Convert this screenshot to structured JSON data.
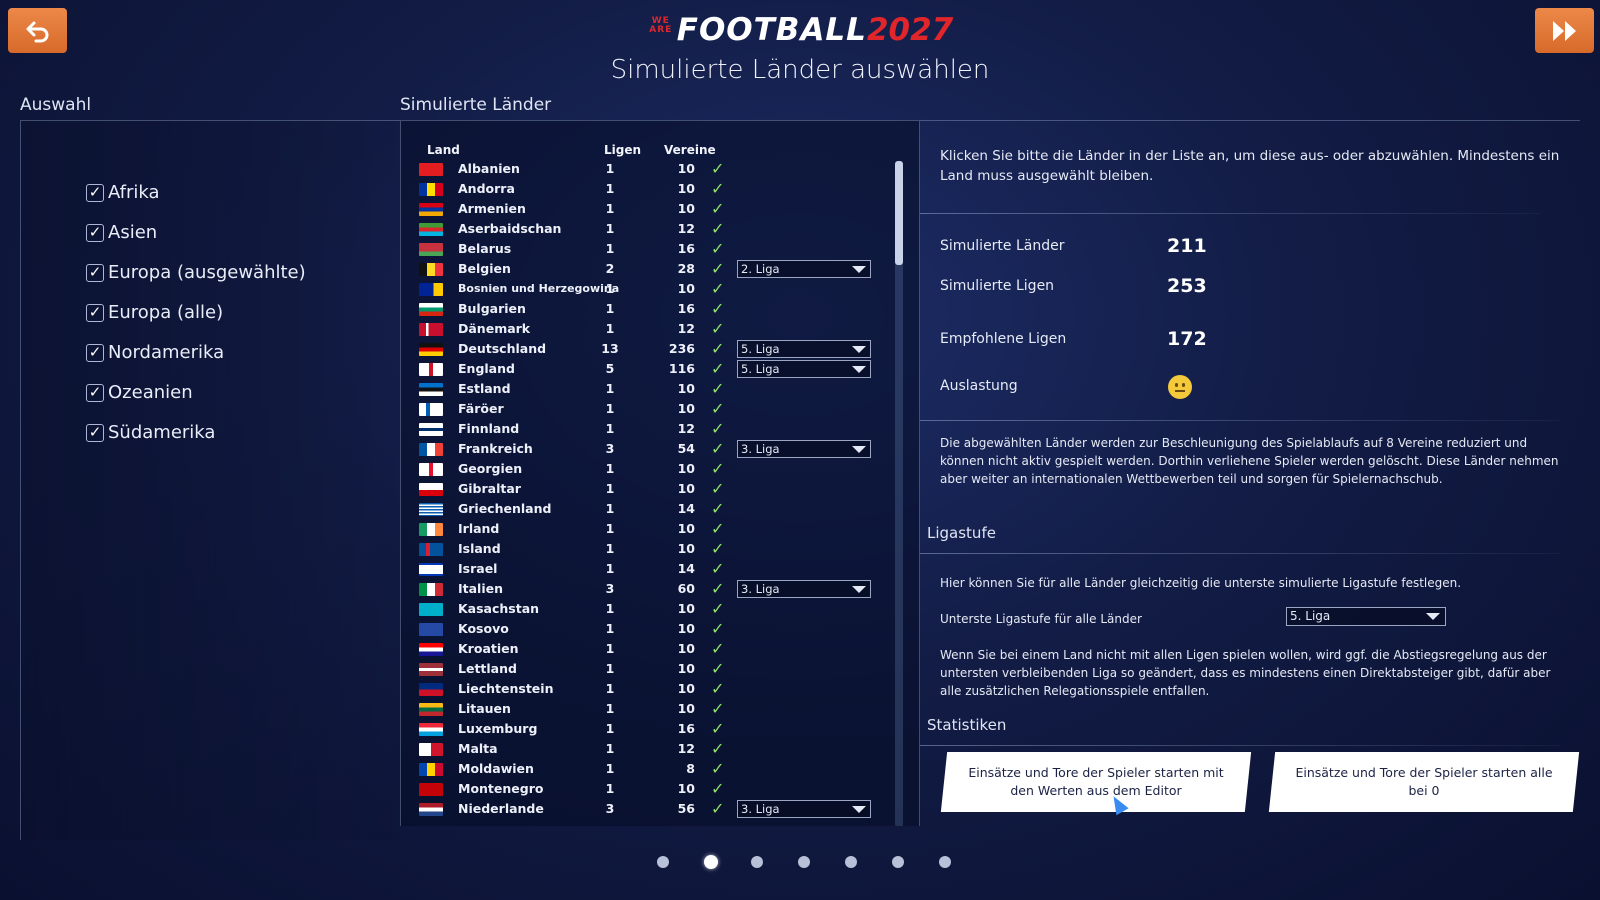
{
  "header": {
    "logo_we": "WE ARE",
    "logo_main": "FOOTBALL",
    "logo_year": "2027",
    "title": "Simulierte Länder auswählen"
  },
  "colors": {
    "accent_orange": "#e47b3a",
    "logo_red": "#e0262b",
    "check_green": "#8fe06a"
  },
  "icons": {
    "back": "undo-arrow-icon",
    "forward": "fast-forward-icon",
    "auslastung": "neutral-face-emoji"
  },
  "selection": {
    "label": "Auswahl",
    "regions": [
      {
        "label": "Afrika",
        "checked": true
      },
      {
        "label": "Asien",
        "checked": true
      },
      {
        "label": "Europa (ausgewählte)",
        "checked": true
      },
      {
        "label": "Europa (alle)",
        "checked": true
      },
      {
        "label": "Nordamerika",
        "checked": true
      },
      {
        "label": "Ozeanien",
        "checked": true
      },
      {
        "label": "Südamerika",
        "checked": true
      }
    ]
  },
  "countries": {
    "label": "Simulierte Länder",
    "headers": {
      "land": "Land",
      "ligen": "Ligen",
      "vereine": "Vereine"
    },
    "rows": [
      {
        "name": "Albanien",
        "leagues": "1",
        "clubs": "10",
        "level": ""
      },
      {
        "name": "Andorra",
        "leagues": "1",
        "clubs": "10",
        "level": ""
      },
      {
        "name": "Armenien",
        "leagues": "1",
        "clubs": "10",
        "level": ""
      },
      {
        "name": "Aserbaidschan",
        "leagues": "1",
        "clubs": "12",
        "level": ""
      },
      {
        "name": "Belarus",
        "leagues": "1",
        "clubs": "16",
        "level": ""
      },
      {
        "name": "Belgien",
        "leagues": "2",
        "clubs": "28",
        "level": "2. Liga"
      },
      {
        "name": "Bosnien und Herzegowina",
        "leagues": "1",
        "clubs": "10",
        "level": ""
      },
      {
        "name": "Bulgarien",
        "leagues": "1",
        "clubs": "16",
        "level": ""
      },
      {
        "name": "Dänemark",
        "leagues": "1",
        "clubs": "12",
        "level": ""
      },
      {
        "name": "Deutschland",
        "leagues": "13",
        "clubs": "236",
        "level": "5. Liga"
      },
      {
        "name": "England",
        "leagues": "5",
        "clubs": "116",
        "level": "5. Liga"
      },
      {
        "name": "Estland",
        "leagues": "1",
        "clubs": "10",
        "level": ""
      },
      {
        "name": "Färöer",
        "leagues": "1",
        "clubs": "10",
        "level": ""
      },
      {
        "name": "Finnland",
        "leagues": "1",
        "clubs": "12",
        "level": ""
      },
      {
        "name": "Frankreich",
        "leagues": "3",
        "clubs": "54",
        "level": "3. Liga"
      },
      {
        "name": "Georgien",
        "leagues": "1",
        "clubs": "10",
        "level": ""
      },
      {
        "name": "Gibraltar",
        "leagues": "1",
        "clubs": "10",
        "level": ""
      },
      {
        "name": "Griechenland",
        "leagues": "1",
        "clubs": "14",
        "level": ""
      },
      {
        "name": "Irland",
        "leagues": "1",
        "clubs": "10",
        "level": ""
      },
      {
        "name": "Island",
        "leagues": "1",
        "clubs": "10",
        "level": ""
      },
      {
        "name": "Israel",
        "leagues": "1",
        "clubs": "14",
        "level": ""
      },
      {
        "name": "Italien",
        "leagues": "3",
        "clubs": "60",
        "level": "3. Liga"
      },
      {
        "name": "Kasachstan",
        "leagues": "1",
        "clubs": "10",
        "level": ""
      },
      {
        "name": "Kosovo",
        "leagues": "1",
        "clubs": "10",
        "level": ""
      },
      {
        "name": "Kroatien",
        "leagues": "1",
        "clubs": "10",
        "level": ""
      },
      {
        "name": "Lettland",
        "leagues": "1",
        "clubs": "10",
        "level": ""
      },
      {
        "name": "Liechtenstein",
        "leagues": "1",
        "clubs": "10",
        "level": ""
      },
      {
        "name": "Litauen",
        "leagues": "1",
        "clubs": "10",
        "level": ""
      },
      {
        "name": "Luxemburg",
        "leagues": "1",
        "clubs": "16",
        "level": ""
      },
      {
        "name": "Malta",
        "leagues": "1",
        "clubs": "12",
        "level": ""
      },
      {
        "name": "Moldawien",
        "leagues": "1",
        "clubs": "8",
        "level": ""
      },
      {
        "name": "Montenegro",
        "leagues": "1",
        "clubs": "10",
        "level": ""
      },
      {
        "name": "Niederlande",
        "leagues": "3",
        "clubs": "56",
        "level": "3. Liga"
      }
    ]
  },
  "info": {
    "intro": "Klicken Sie bitte die Länder in der Liste an, um diese aus- oder abzuwählen. Mindestens ein Land muss ausgewählt bleiben.",
    "stats": {
      "simulated_countries_label": "Simulierte Länder",
      "simulated_countries_value": "211",
      "simulated_leagues_label": "Simulierte Ligen",
      "simulated_leagues_value": "253",
      "recommended_leagues_label": "Empfohlene Ligen",
      "recommended_leagues_value": "172",
      "load_label": "Auslastung"
    },
    "deselected_note": "Die abgewählten Länder werden zur Beschleunigung des Spielablaufs auf 8 Vereine reduziert und können nicht aktiv gespielt werden. Dorthin verliehene Spieler werden gelöscht. Diese Länder nehmen aber weiter an internationalen Wettbewerben teil und sorgen für Spielernachschub."
  },
  "ligastufe": {
    "heading": "Ligastufe",
    "description": "Hier können Sie für alle Länder gleichzeitig die unterste simulierte Ligastufe festlegen.",
    "field_label": "Unterste Ligastufe für alle Länder",
    "selected": "5. Liga",
    "note": "Wenn Sie bei einem Land nicht mit allen Ligen spielen wollen, wird ggf. die Abstiegsregelung aus der untersten verbleibenden Liga so geändert, dass es mindestens einen Direktabsteiger gibt, dafür aber alle zusätzlichen Relegationsspiele entfallen."
  },
  "statistiken": {
    "heading": "Statistiken",
    "button_editor": "Einsätze und Tore der Spieler starten mit den Werten aus dem Editor",
    "button_zero": "Einsätze und Tore der Spieler starten alle bei 0"
  },
  "pagination": {
    "total": 7,
    "current": 2
  }
}
